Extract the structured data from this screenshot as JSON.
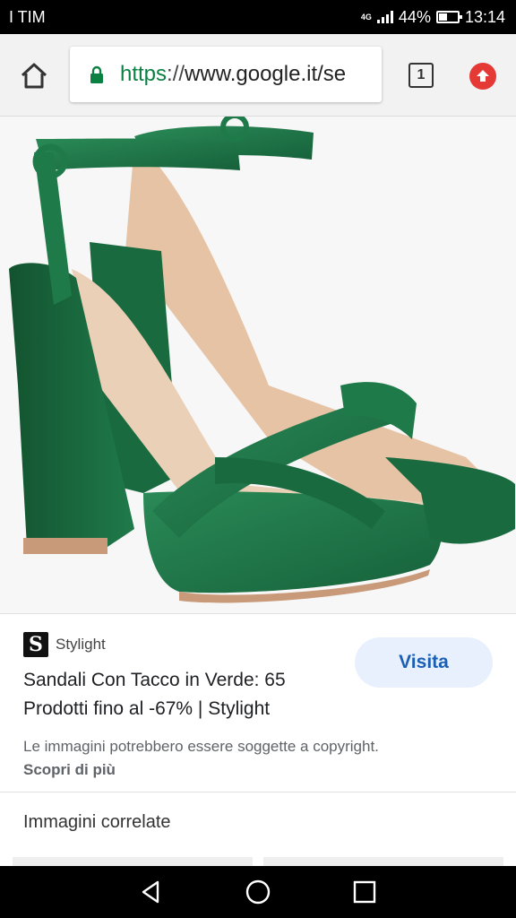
{
  "status": {
    "carrier": "I TIM",
    "network": "4G",
    "battery_percent": "44%",
    "battery_level": 0.44,
    "time": "13:14"
  },
  "browser": {
    "url_scheme": "https",
    "url_sep": "://",
    "url_rest": "www.google.it/se",
    "tab_count": "1",
    "icons": [
      "home-icon",
      "lock-icon",
      "tab-switcher-icon",
      "update-icon"
    ]
  },
  "result": {
    "source_logo": "S",
    "source_name": "Stylight",
    "title": "Sandali Con Tacco in Verde: 65 Prodotti fino al -67% | Stylight",
    "visit_label": "Visita",
    "copyright_notice": "Le immagini potrebbero essere soggette a copyright.",
    "learn_more": "Scopri di più"
  },
  "related": {
    "label": "Immagini correlate"
  },
  "colors": {
    "shoe_green": "#1f7a4a",
    "visit_bg": "#e8f0fe",
    "visit_text": "#1a5fb4",
    "lock_green": "#0b8043",
    "update_red": "#e53935"
  },
  "nav": {
    "icons": [
      "back-icon",
      "home-circle-icon",
      "recents-icon"
    ]
  }
}
